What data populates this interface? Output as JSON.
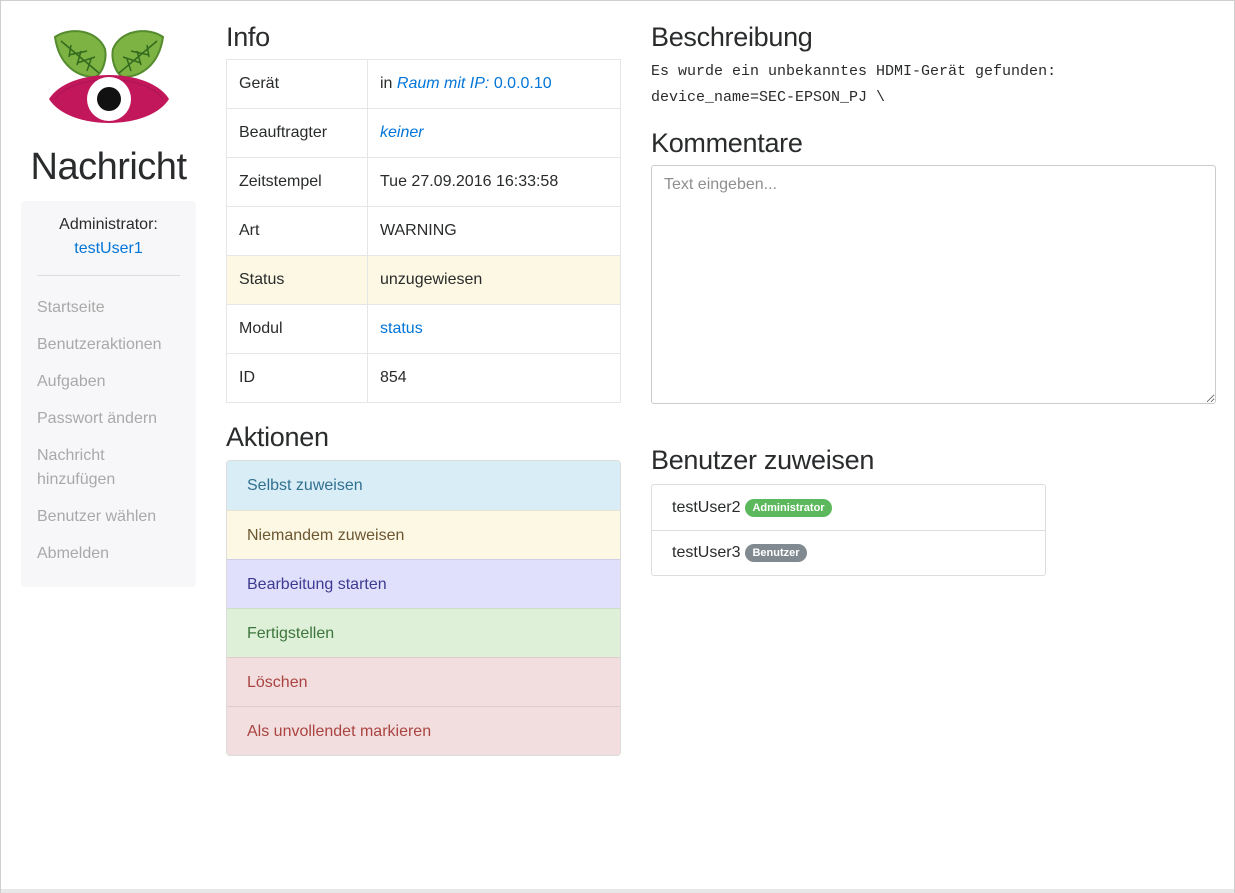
{
  "brand": {
    "title": "Nachricht"
  },
  "colors": {
    "link": "#0275d8",
    "warning_row": "#fcf8e3",
    "badge_admin": "#5cb85c",
    "badge_user": "#818a91"
  },
  "sidebar": {
    "admin_label": "Administrator:",
    "admin_user": "testUser1",
    "nav": [
      {
        "label": "Startseite"
      },
      {
        "label": "Benutzeraktionen"
      },
      {
        "label": "Aufgaben"
      },
      {
        "label": "Passwort ändern"
      },
      {
        "label": "Nachricht hinzufügen"
      },
      {
        "label": "Benutzer wählen"
      },
      {
        "label": "Abmelden"
      }
    ]
  },
  "info": {
    "title": "Info",
    "rows": {
      "device": {
        "label": "Gerät",
        "prefix": "in ",
        "room_text": "Raum mit IP:",
        "ip": "0.0.0.10"
      },
      "assignee": {
        "label": "Beauftragter",
        "value": "keiner"
      },
      "timestamp": {
        "label": "Zeitstempel",
        "value": "Tue 27.09.2016 16:33:58"
      },
      "type": {
        "label": "Art",
        "value": "WARNING"
      },
      "status": {
        "label": "Status",
        "value": "unzugewiesen"
      },
      "module": {
        "label": "Modul",
        "value": "status"
      },
      "id": {
        "label": "ID",
        "value": "854"
      }
    }
  },
  "actions": {
    "title": "Aktionen",
    "items": [
      {
        "label": "Selbst zuweisen"
      },
      {
        "label": "Niemandem zuweisen"
      },
      {
        "label": "Bearbeitung starten"
      },
      {
        "label": "Fertigstellen"
      },
      {
        "label": "Löschen"
      },
      {
        "label": "Als unvollendet markieren"
      }
    ]
  },
  "description": {
    "title": "Beschreibung",
    "line1": "Es wurde ein unbekanntes HDMI-Gerät gefunden:",
    "line2": "device_name=SEC-EPSON_PJ \\"
  },
  "comments": {
    "title": "Kommentare",
    "placeholder": "Text eingeben...",
    "value": ""
  },
  "assign": {
    "title": "Benutzer zuweisen",
    "users": [
      {
        "name": "testUser2",
        "role": "Administrator"
      },
      {
        "name": "testUser3",
        "role": "Benutzer"
      }
    ]
  }
}
